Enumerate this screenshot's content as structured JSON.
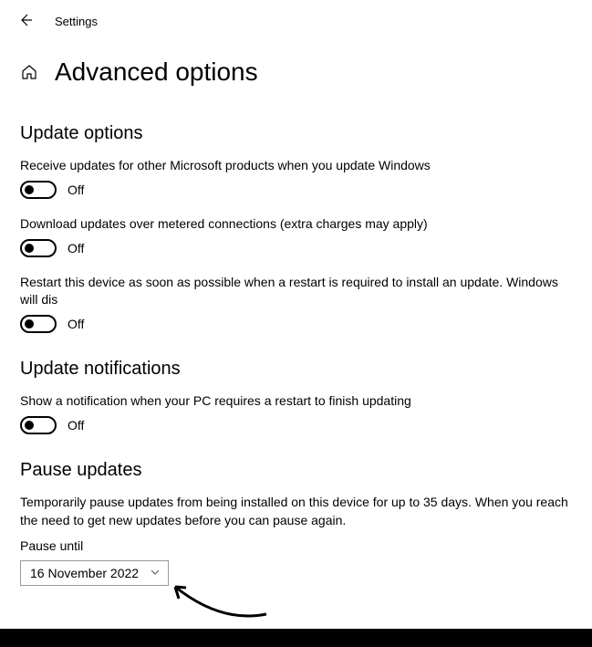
{
  "top": {
    "settings_label": "Settings"
  },
  "heading": "Advanced options",
  "sections": {
    "update_options": {
      "title": "Update options",
      "opt1": {
        "label": "Receive updates for other Microsoft products when you update Windows",
        "state": "Off"
      },
      "opt2": {
        "label": "Download updates over metered connections (extra charges may apply)",
        "state": "Off"
      },
      "opt3": {
        "label": "Restart this device as soon as possible when a restart is required to install an update. Windows will dis",
        "state": "Off"
      }
    },
    "notifications": {
      "title": "Update notifications",
      "opt1": {
        "label": "Show a notification when your PC requires a restart to finish updating",
        "state": "Off"
      }
    },
    "pause": {
      "title": "Pause updates",
      "desc": "Temporarily pause updates from being installed on this device for up to 35 days. When you reach the need to get new updates before you can pause again.",
      "field_label": "Pause until",
      "selected": "16 November 2022"
    }
  }
}
